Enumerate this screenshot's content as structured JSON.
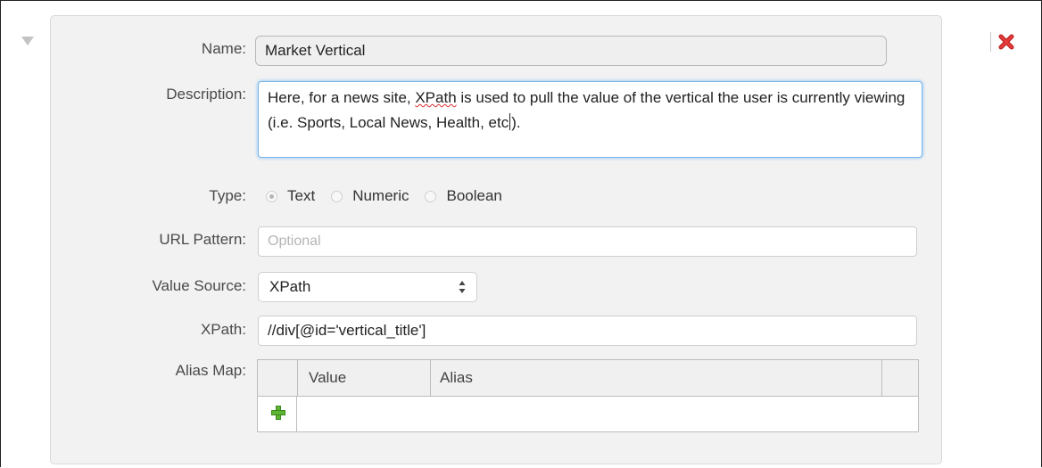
{
  "form": {
    "name_label": "Name:",
    "name_value": "Market Vertical",
    "description_label": "Description:",
    "description": {
      "part1": "Here, for a news site, ",
      "misspelled": "XPath",
      "part2": " is used to pull the value of the vertical the user is currently viewing (i.e. Sports, Local News, Health, etc",
      "part3": ")."
    },
    "type_label": "Type:",
    "type_options": [
      "Text",
      "Numeric",
      "Boolean"
    ],
    "type_selected": "Text",
    "url_pattern_label": "URL Pattern:",
    "url_pattern_placeholder": "Optional",
    "url_pattern_value": "",
    "value_source_label": "Value Source:",
    "value_source_selected": "XPath",
    "xpath_label": "XPath:",
    "xpath_value": "//div[@id='vertical_title']",
    "alias_map_label": "Alias Map:",
    "alias_map": {
      "columns": [
        "Value",
        "Alias"
      ],
      "rows": []
    }
  },
  "icons": {
    "collapse": "collapse-triangle-icon",
    "remove": "remove-x-icon",
    "add": "add-plus-icon"
  },
  "colors": {
    "panel_bg": "#f2f2f2",
    "focus_border": "#7fb6ea",
    "remove_red": "#d62828",
    "add_green": "#5fb332"
  }
}
